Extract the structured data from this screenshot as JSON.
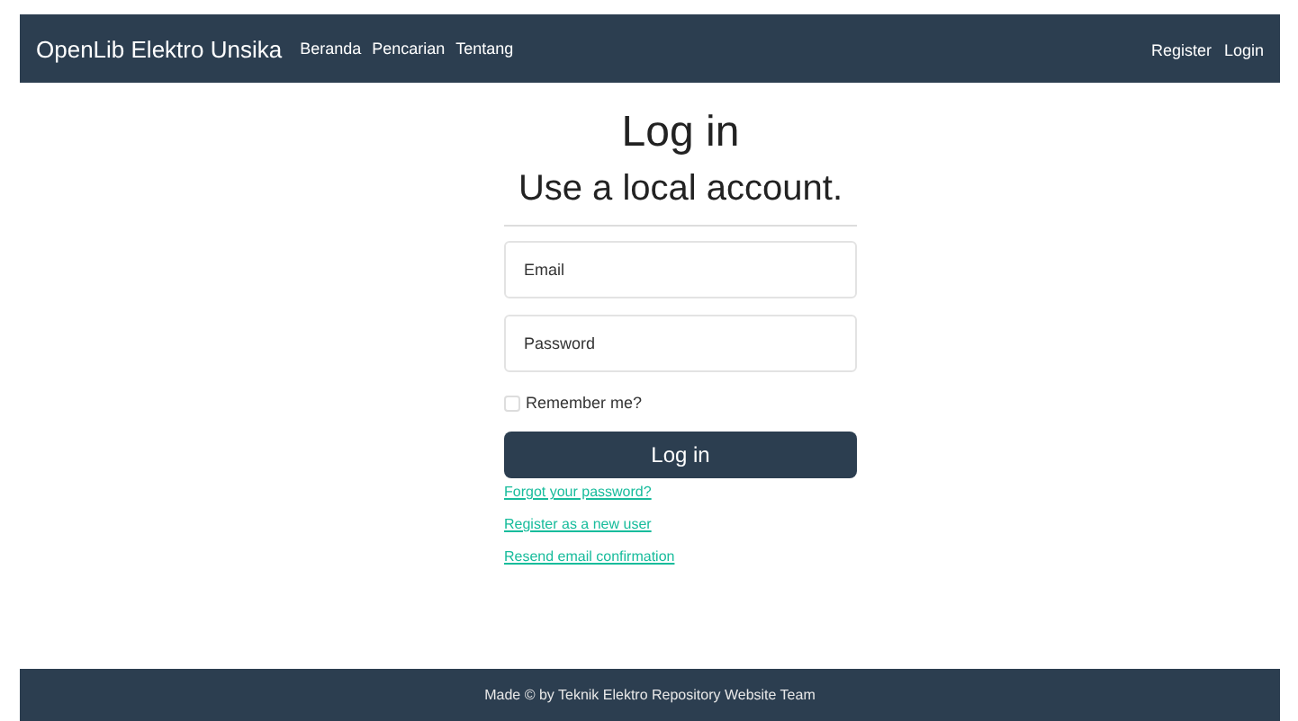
{
  "navbar": {
    "brand": "OpenLib Elektro Unsika",
    "links": [
      "Beranda",
      "Pencarian",
      "Tentang"
    ],
    "right_links": [
      "Register",
      "Login"
    ]
  },
  "heading": "Log in",
  "subheading": "Use a local account.",
  "form": {
    "fields": [
      {
        "placeholder": "Email"
      },
      {
        "placeholder": "Password"
      }
    ],
    "remember": {
      "label": "Remember me?",
      "checked": false
    },
    "submit": "Log in",
    "links": [
      "Forgot your password?",
      "Register as a new user",
      "Resend email confirmation"
    ]
  },
  "footer": "Made © by Teknik Elektro Repository Website Team"
}
